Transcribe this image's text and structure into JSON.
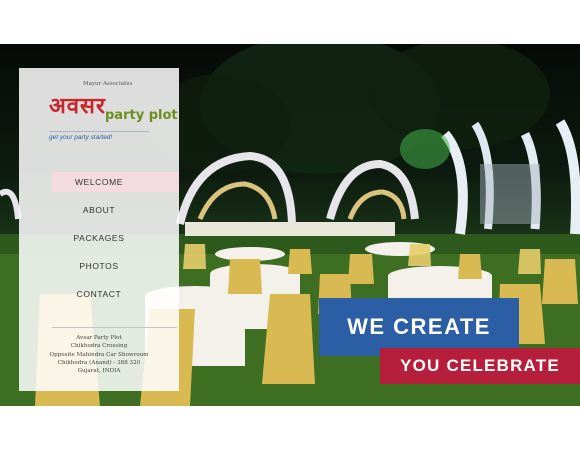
{
  "brand": {
    "associates": "Mayur Associates",
    "logo_text": "अवसर",
    "logo_subtitle": "party plot",
    "tagline": "get your party started!"
  },
  "nav": {
    "items": [
      {
        "label": "WELCOME",
        "active": true
      },
      {
        "label": "ABOUT",
        "active": false
      },
      {
        "label": "PACKAGES",
        "active": false
      },
      {
        "label": "PHOTOS",
        "active": false
      },
      {
        "label": "CONTACT",
        "active": false
      }
    ]
  },
  "address": {
    "name": "Avsar Party Plot",
    "line1": "Chikhodra Crossing",
    "line2": "Opposite Mahindra Car Showroom",
    "line3": "Chikhodra (Anand) - 388 320",
    "line4": "Gujarat, INDIA"
  },
  "slogan": {
    "line1": "WE CREATE",
    "line2": "YOU CELEBRATE"
  },
  "colors": {
    "logo_red": "#c8262d",
    "logo_green": "#6a8f1f",
    "tagline_blue": "#2d5aa5",
    "slogan_blue": "#2c5ea6",
    "slogan_red": "#b51f3c",
    "nav_active_bg": "#f4dbe0"
  }
}
